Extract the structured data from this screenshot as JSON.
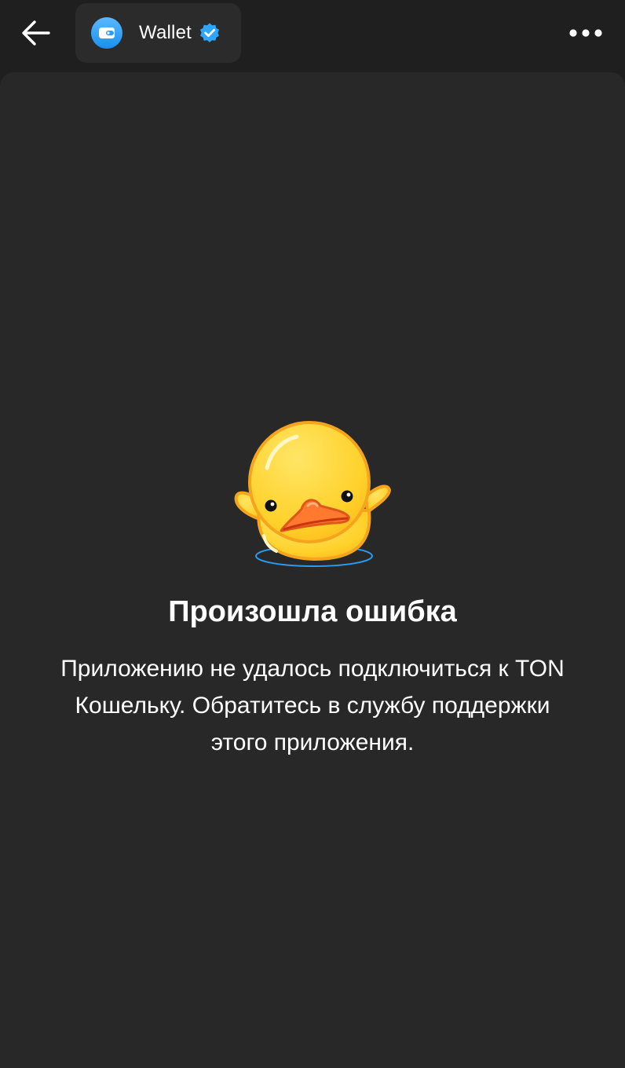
{
  "header": {
    "back_icon": "arrow-left-icon",
    "app_name": "Wallet",
    "app_icon": "wallet-icon",
    "verified_icon": "verified-badge-icon",
    "menu_icon": "more-horizontal-icon"
  },
  "error": {
    "illustration": "duck-shrug-sticker",
    "title": "Произошла ошибка",
    "message": "Приложению не удалось подключиться к TON Кошельку. Обратитесь в службу поддержки этого приложения."
  },
  "colors": {
    "background": "#1f1f1f",
    "sheet": "#282828",
    "chip": "#2b2b2b",
    "accent_blue": "#2ea6ff",
    "duck_yellow": "#ffd233",
    "beak_orange": "#ff7a2e"
  }
}
